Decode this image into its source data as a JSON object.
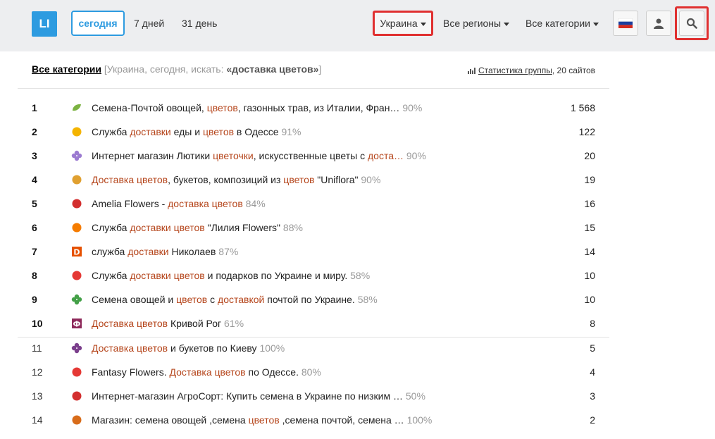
{
  "header": {
    "logo": "LI",
    "periods": [
      "сегодня",
      "7 дней",
      "31 день"
    ],
    "country": "Украина",
    "regions": "Все регионы",
    "categories": "Все категории"
  },
  "subheader": {
    "category_link": "Все категории",
    "context_prefix": "[Украина, сегодня, искать: ",
    "query": "«доставка цветов»",
    "context_suffix": "]",
    "stats_link": "Статистика группы",
    "stats_count": ", 20 сайтов"
  },
  "rows": [
    {
      "rank": "1",
      "parts": [
        "Семена-Почтой овощей, ",
        "цветов",
        ", газонных трав, из Италии, Фран…"
      ],
      "pct": "90%",
      "count": "1 568",
      "icon": "leaf-icon",
      "color": "#7cb342"
    },
    {
      "rank": "2",
      "parts": [
        "Служба ",
        "доставки",
        " еды и ",
        "цветов",
        " в Одессе"
      ],
      "pct": "91%",
      "count": "122",
      "icon": "delivery-icon",
      "color": "#f4b400"
    },
    {
      "rank": "3",
      "parts": [
        "Интернет магазин Лютики ",
        "цветочки",
        ", искусственные цветы с ",
        "доста…"
      ],
      "pct": "90%",
      "count": "20",
      "icon": "flower-icon",
      "color": "#9c7bd1"
    },
    {
      "rank": "4",
      "parts": [
        "Доставка цветов",
        ", букетов, композиций из ",
        "цветов",
        " \"Uniflora\""
      ],
      "pct": "90%",
      "count": "19",
      "icon": "bouquet-icon",
      "color": "#e0a030"
    },
    {
      "rank": "5",
      "parts": [
        "Amelia Flowers - ",
        "доставка цветов"
      ],
      "pct": "84%",
      "count": "16",
      "icon": "rose-icon",
      "color": "#d32f2f"
    },
    {
      "rank": "6",
      "parts": [
        "Служба ",
        "доставки цветов",
        " \"Лилия Flowers\""
      ],
      "pct": "88%",
      "count": "15",
      "icon": "lily-icon",
      "color": "#f57c00"
    },
    {
      "rank": "7",
      "parts": [
        "служба ",
        "доставки",
        " Николаев"
      ],
      "pct": "87%",
      "count": "14",
      "icon": "d-icon",
      "color": "#e65100"
    },
    {
      "rank": "8",
      "parts": [
        "Служба ",
        "доставки цветов",
        " и подарков по Украине и миру."
      ],
      "pct": "58%",
      "count": "10",
      "icon": "basket-icon",
      "color": "#e53935"
    },
    {
      "rank": "9",
      "parts": [
        "Семена овощей и ",
        "цветов",
        " с ",
        "доставкой",
        " почтой по Украине."
      ],
      "pct": "58%",
      "count": "10",
      "icon": "clover-icon",
      "color": "#43a047"
    },
    {
      "rank": "10",
      "parts": [
        "Доставка цветов",
        " Кривой Рог"
      ],
      "pct": "61%",
      "count": "8",
      "icon": "phi-icon",
      "color": "#8e2a5b"
    },
    {
      "rank": "11",
      "parts": [
        "Доставка цветов",
        " и букетов по Киеву"
      ],
      "pct": "100%",
      "count": "5",
      "icon": "star-icon",
      "color": "#7b3f8c"
    },
    {
      "rank": "12",
      "parts": [
        "Fantasy Flowers. ",
        "Доставка цветов",
        " по Одессе."
      ],
      "pct": "80%",
      "count": "4",
      "icon": "tulip-icon",
      "color": "#e53935"
    },
    {
      "rank": "13",
      "parts": [
        "Интернет-магазин АгроСорт: Купить семена в Украине по низким …"
      ],
      "pct": "50%",
      "count": "3",
      "icon": "tomato-icon",
      "color": "#d32f2f"
    },
    {
      "rank": "14",
      "parts": [
        "Магазин: семена овощей ,семена ",
        "цветов",
        " ,семена почтой, семена …"
      ],
      "pct": "100%",
      "count": "2",
      "icon": "dot-icon",
      "color": "#d86c1a"
    }
  ]
}
